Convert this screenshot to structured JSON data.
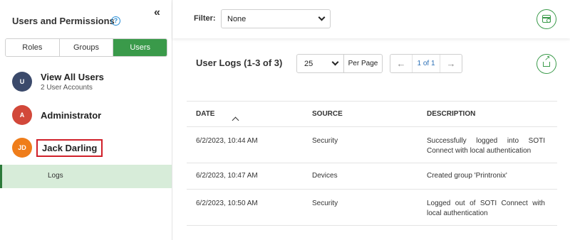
{
  "left_panel": {
    "title": "Users and Permissions",
    "help_icon": "?",
    "collapse_icon": "«",
    "tabs": [
      {
        "label": "Roles",
        "active": false
      },
      {
        "label": "Groups",
        "active": false
      },
      {
        "label": "Users",
        "active": true
      }
    ],
    "users": [
      {
        "initials": "U",
        "name": "View All Users",
        "subtitle": "2 User Accounts",
        "avatar_color": "#3b4a6b"
      },
      {
        "initials": "A",
        "name": "Administrator",
        "subtitle": "",
        "avatar_color": "#d2483a"
      },
      {
        "initials": "JD",
        "name": "Jack Darling",
        "subtitle": "",
        "avatar_color": "#ef7d1a"
      }
    ],
    "sub_item": "Logs"
  },
  "toolbar": {
    "filter_label": "Filter:",
    "filter_value": "None",
    "calendar_icon": "calendar-icon"
  },
  "logs": {
    "heading": "User Logs (1-3 of 3)",
    "per_page_value": "25",
    "per_page_label": "Per Page",
    "prev": "←",
    "next": "→",
    "page": "1 of 1",
    "export_icon": "export-icon"
  },
  "table": {
    "headers": {
      "date": "DATE",
      "source": "SOURCE",
      "description": "DESCRIPTION"
    },
    "rows": [
      {
        "date": "6/2/2023, 10:44 AM",
        "source": "Security",
        "description": "Successfully logged into SOTI Connect with local authentication"
      },
      {
        "date": "6/2/2023, 10:47 AM",
        "source": "Devices",
        "description": "Created group 'Printronix'"
      },
      {
        "date": "6/2/2023, 10:50 AM",
        "source": "Security",
        "description": "Logged out of SOTI Connect with local authentication"
      }
    ]
  },
  "colors": {
    "accent_green": "#3a9a4a",
    "selected_bg": "#d7ecd9",
    "highlight_red": "#d0202a",
    "link_blue": "#2b6fb6"
  }
}
